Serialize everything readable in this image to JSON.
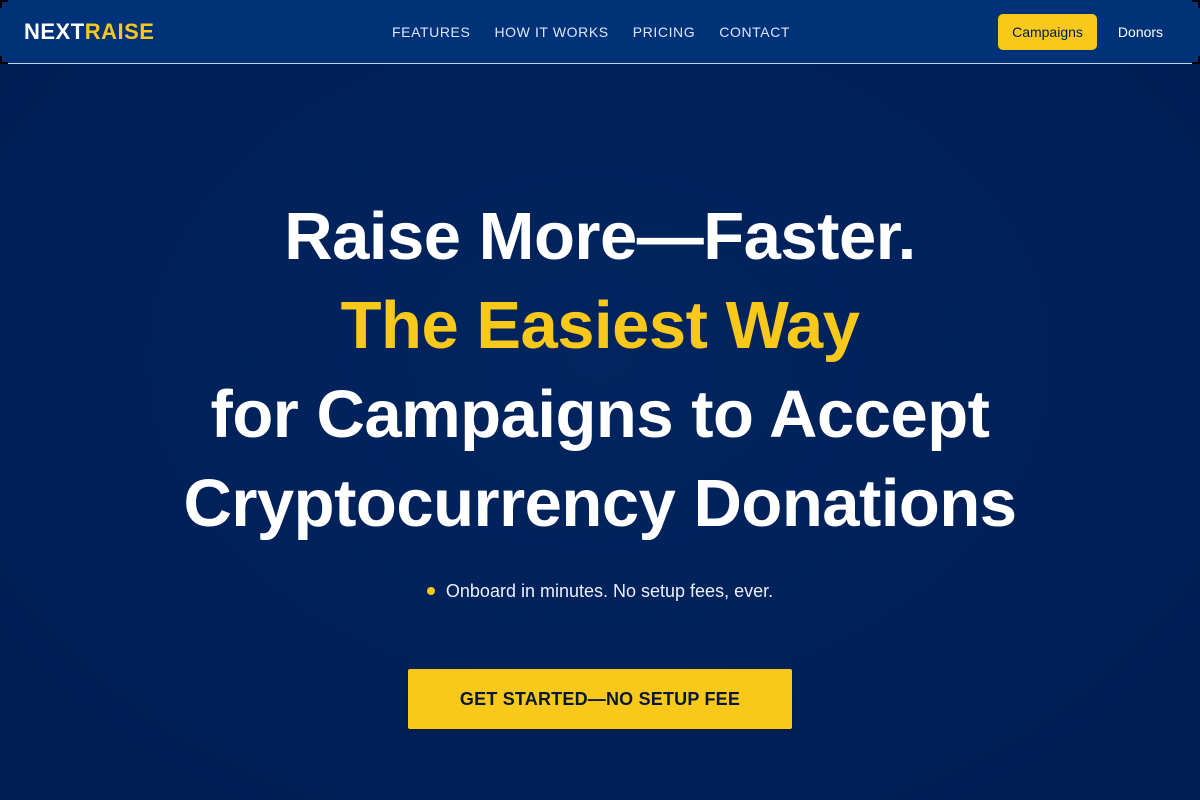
{
  "brand": {
    "name_part1": "NEXT",
    "name_part2": "RAISE",
    "accent_color": "#f8c81b",
    "background_color": "#00327a"
  },
  "nav": {
    "items": [
      {
        "label": "FEATURES"
      },
      {
        "label": "HOW IT WORKS"
      },
      {
        "label": "PRICING"
      },
      {
        "label": "CONTACT"
      }
    ]
  },
  "header_buttons": {
    "campaigns": "Campaigns",
    "donors": "Donors"
  },
  "hero": {
    "line1": "Raise More—Faster.",
    "line2": "The Easiest Way",
    "line3": "for Campaigns to Accept",
    "line4": "Cryptocurrency Donations",
    "bullet": "Onboard in minutes. No setup fees, ever.",
    "cta_label": "GET STARTED—NO SETUP FEE"
  }
}
